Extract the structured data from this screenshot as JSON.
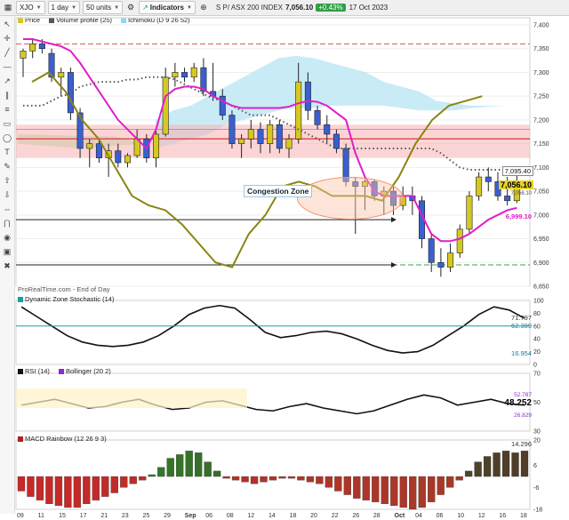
{
  "toolbar": {
    "symbol": "XJO",
    "period": "1 day",
    "units": "50 units",
    "indicators": "Indicators",
    "instrument": "S P/ ASX 200 INDEX",
    "price": "7,056.10",
    "change": "+0.43%",
    "date": "17 Oct 2023"
  },
  "legend": {
    "price": "Price",
    "volume_profile": "Volume profile (25)",
    "ichimoku": "Ichimoku (D 9 26 52)"
  },
  "panels": {
    "source": "ProRealTime.com - End of Day",
    "stoch": "Dynamic Zone Stochastic (14)",
    "rsi": "RSI (14)",
    "bollinger": "Bollinger (20 2)",
    "macd": "MACD Rainbow (12 26 9 3)"
  },
  "annotation": "Congestion Zone",
  "price_tags": {
    "cloud": "7,095.40",
    "last": "7,056.10",
    "small": "7,056.10",
    "kijun": "6,999.10"
  },
  "stoch_tags": {
    "upper": "71.797",
    "mid": "62.399",
    "lower": "16.954"
  },
  "rsi_tags": {
    "value": "48.252",
    "upper": "52.787",
    "lower": "26.829"
  },
  "macd_tags": {
    "value": "14.296"
  },
  "colors": {
    "up": "#d6c820",
    "down": "#3a5fd0",
    "tenkan": "#e01ec8",
    "lagging": "#8a8410",
    "cloud": "#bfe8f5",
    "resistance": "#f7b3b3"
  },
  "chart_data": {
    "type": "candlestick",
    "price_axis": {
      "min": 6850,
      "max": 7400,
      "ticks": [
        7400,
        7350,
        7300,
        7250,
        7200,
        7150,
        7100,
        7050,
        7000,
        6950,
        6900,
        6850
      ]
    },
    "dates": [
      "09",
      "11",
      "15",
      "17",
      "21",
      "23",
      "25",
      "29",
      "Sep",
      "06",
      "08",
      "12",
      "14",
      "18",
      "20",
      "22",
      "26",
      "28",
      "Oct",
      "04",
      "06",
      "10",
      "12",
      "16",
      "18"
    ],
    "candles": [
      {
        "o": 7330,
        "h": 7350,
        "l": 7290,
        "c": 7345
      },
      {
        "o": 7345,
        "h": 7370,
        "l": 7330,
        "c": 7360
      },
      {
        "o": 7360,
        "h": 7370,
        "l": 7340,
        "c": 7350
      },
      {
        "o": 7340,
        "h": 7350,
        "l": 7280,
        "c": 7290
      },
      {
        "o": 7290,
        "h": 7310,
        "l": 7250,
        "c": 7300
      },
      {
        "o": 7300,
        "h": 7310,
        "l": 7200,
        "c": 7215
      },
      {
        "o": 7215,
        "h": 7225,
        "l": 7120,
        "c": 7140
      },
      {
        "o": 7140,
        "h": 7160,
        "l": 7100,
        "c": 7150
      },
      {
        "o": 7150,
        "h": 7160,
        "l": 7110,
        "c": 7120
      },
      {
        "o": 7120,
        "h": 7150,
        "l": 7080,
        "c": 7135
      },
      {
        "o": 7135,
        "h": 7150,
        "l": 7100,
        "c": 7110
      },
      {
        "o": 7110,
        "h": 7130,
        "l": 7100,
        "c": 7125
      },
      {
        "o": 7125,
        "h": 7180,
        "l": 7120,
        "c": 7160
      },
      {
        "o": 7160,
        "h": 7170,
        "l": 7110,
        "c": 7120
      },
      {
        "o": 7120,
        "h": 7180,
        "l": 7100,
        "c": 7170
      },
      {
        "o": 7170,
        "h": 7310,
        "l": 7165,
        "c": 7290
      },
      {
        "o": 7290,
        "h": 7320,
        "l": 7270,
        "c": 7300
      },
      {
        "o": 7300,
        "h": 7310,
        "l": 7280,
        "c": 7290
      },
      {
        "o": 7290,
        "h": 7320,
        "l": 7280,
        "c": 7310
      },
      {
        "o": 7310,
        "h": 7330,
        "l": 7250,
        "c": 7260
      },
      {
        "o": 7260,
        "h": 7320,
        "l": 7240,
        "c": 7250
      },
      {
        "o": 7250,
        "h": 7265,
        "l": 7200,
        "c": 7210
      },
      {
        "o": 7210,
        "h": 7220,
        "l": 7140,
        "c": 7150
      },
      {
        "o": 7150,
        "h": 7170,
        "l": 7120,
        "c": 7160
      },
      {
        "o": 7160,
        "h": 7200,
        "l": 7140,
        "c": 7180
      },
      {
        "o": 7180,
        "h": 7195,
        "l": 7130,
        "c": 7150
      },
      {
        "o": 7150,
        "h": 7200,
        "l": 7130,
        "c": 7190
      },
      {
        "o": 7190,
        "h": 7200,
        "l": 7130,
        "c": 7140
      },
      {
        "o": 7140,
        "h": 7170,
        "l": 7120,
        "c": 7160
      },
      {
        "o": 7160,
        "h": 7320,
        "l": 7150,
        "c": 7280
      },
      {
        "o": 7280,
        "h": 7300,
        "l": 7200,
        "c": 7220
      },
      {
        "o": 7220,
        "h": 7230,
        "l": 7180,
        "c": 7190
      },
      {
        "o": 7190,
        "h": 7210,
        "l": 7150,
        "c": 7170
      },
      {
        "o": 7170,
        "h": 7180,
        "l": 7130,
        "c": 7140
      },
      {
        "o": 7140,
        "h": 7150,
        "l": 7060,
        "c": 7070
      },
      {
        "o": 7070,
        "h": 7080,
        "l": 6960,
        "c": 7060
      },
      {
        "o": 7060,
        "h": 7075,
        "l": 7010,
        "c": 7070
      },
      {
        "o": 7070,
        "h": 7075,
        "l": 7030,
        "c": 7040
      },
      {
        "o": 7040,
        "h": 7060,
        "l": 7000,
        "c": 7050
      },
      {
        "o": 7050,
        "h": 7060,
        "l": 7000,
        "c": 7020
      },
      {
        "o": 7020,
        "h": 7060,
        "l": 7010,
        "c": 7040
      },
      {
        "o": 7040,
        "h": 7060,
        "l": 7000,
        "c": 7030
      },
      {
        "o": 7030,
        "h": 7040,
        "l": 6930,
        "c": 6950
      },
      {
        "o": 6950,
        "h": 6960,
        "l": 6880,
        "c": 6900
      },
      {
        "o": 6900,
        "h": 6930,
        "l": 6870,
        "c": 6890
      },
      {
        "o": 6890,
        "h": 6940,
        "l": 6880,
        "c": 6920
      },
      {
        "o": 6920,
        "h": 6980,
        "l": 6910,
        "c": 6970
      },
      {
        "o": 6970,
        "h": 7050,
        "l": 6960,
        "c": 7040
      },
      {
        "o": 7040,
        "h": 7090,
        "l": 7030,
        "c": 7080
      },
      {
        "o": 7080,
        "h": 7100,
        "l": 7050,
        "c": 7070
      },
      {
        "o": 7070,
        "h": 7090,
        "l": 7030,
        "c": 7040
      },
      {
        "o": 7040,
        "h": 7080,
        "l": 7020,
        "c": 7030
      },
      {
        "o": 7030,
        "h": 7090,
        "l": 7025,
        "c": 7056
      }
    ],
    "tenkan": [
      7370,
      7370,
      7365,
      7360,
      7355,
      7345,
      7320,
      7290,
      7260,
      7230,
      7200,
      7180,
      7160,
      7140,
      7180,
      7250,
      7265,
      7270,
      7270,
      7265,
      7250,
      7240,
      7230,
      7225,
      7225,
      7225,
      7225,
      7225,
      7228,
      7235,
      7240,
      7238,
      7230,
      7215,
      7200,
      7130,
      7080,
      7050,
      7040,
      7040,
      7040,
      7040,
      7000,
      6960,
      6945,
      6945,
      6950,
      6960,
      6975,
      6990,
      7000,
      7010,
      7015
    ],
    "kijun_dotted": [
      7230,
      7230,
      7230,
      7240,
      7250,
      7255,
      7270,
      7275,
      7280,
      7280,
      7280,
      7285,
      7285,
      7290,
      7290,
      7290,
      7285,
      7275,
      7265,
      7255,
      7245,
      7240,
      7230,
      7220,
      7210,
      7210,
      7210,
      7200,
      7190,
      7180,
      7170,
      7160,
      7150,
      7140,
      7140,
      7140,
      7140,
      7140,
      7140,
      7140,
      7140,
      7140,
      7140,
      7140,
      7130,
      7115,
      7100,
      7095,
      7095,
      7095,
      7095,
      7095,
      7095
    ],
    "lagging": [
      7280,
      7300,
      7260,
      7200,
      7160,
      7100,
      7040,
      7020,
      7010,
      6980,
      6940,
      6900,
      6890,
      6960,
      7000,
      7060,
      7070,
      7060,
      7040,
      7040,
      7040,
      7030,
      7080,
      7150,
      7200,
      7230,
      7240,
      7250
    ],
    "resistance_levels": [
      7360,
      7160
    ],
    "support_levels": [
      6990,
      6895
    ],
    "stochastic": {
      "axis": [
        100,
        80,
        60,
        40,
        20,
        0
      ],
      "values": [
        90,
        75,
        60,
        45,
        35,
        30,
        28,
        30,
        35,
        45,
        60,
        78,
        88,
        92,
        88,
        70,
        50,
        42,
        45,
        50,
        52,
        48,
        40,
        30,
        22,
        18,
        20,
        30,
        45,
        60,
        78,
        90,
        85,
        72
      ]
    },
    "rsi": {
      "axis": [
        70,
        50,
        30
      ],
      "values": [
        48,
        50,
        52,
        49,
        46,
        47,
        50,
        52,
        48,
        45,
        46,
        50,
        51,
        48,
        45,
        44,
        47,
        49,
        46,
        44,
        42,
        44,
        48,
        52,
        55,
        53,
        48,
        50,
        52,
        49,
        48
      ]
    },
    "macd": {
      "axis": [
        20,
        6,
        -6,
        -18
      ],
      "values": [
        -8,
        -11,
        -13,
        -15,
        -16,
        -17,
        -17,
        -15,
        -13,
        -11,
        -9,
        -6,
        -4,
        -2,
        1,
        5,
        10,
        12,
        14,
        13,
        8,
        3,
        -1,
        -2,
        -3,
        -4,
        -3,
        -2,
        -1,
        -1,
        -2,
        -3,
        -4,
        -6,
        -8,
        -10,
        -12,
        -13,
        -14,
        -15,
        -16,
        -17,
        -18,
        -17,
        -14,
        -10,
        -6,
        -2,
        3,
        8,
        11,
        13,
        14,
        13,
        14
      ]
    }
  }
}
